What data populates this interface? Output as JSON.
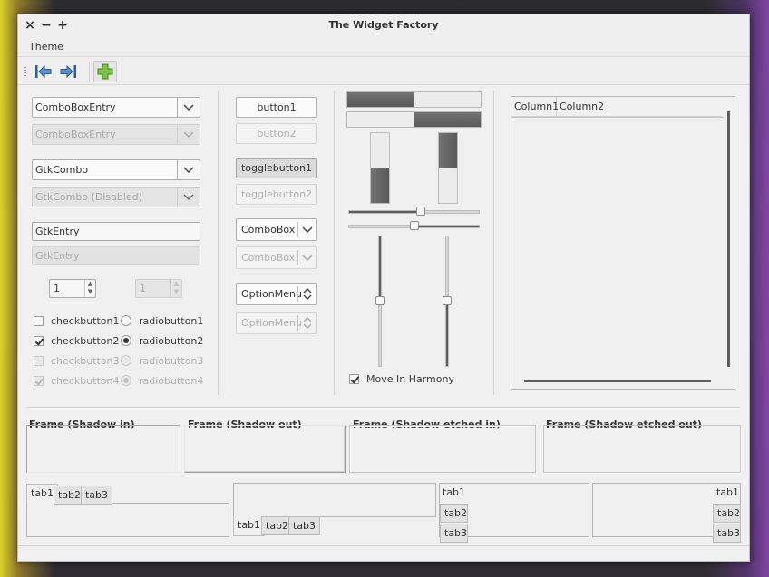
{
  "window": {
    "title": "The Widget Factory"
  },
  "titlebar": {
    "close": "×",
    "minimize": "−",
    "maximize": "+"
  },
  "menubar": {
    "items": [
      "Theme"
    ]
  },
  "toolbar": {
    "items": [
      "go-first-icon",
      "go-last-icon",
      "add-icon"
    ]
  },
  "col1": {
    "combo_entry": "ComboBoxEntry",
    "combo_entry_disabled": "ComboBoxEntry",
    "gtk_combo": "GtkCombo",
    "gtk_combo_disabled": "GtkCombo (Disabled)",
    "entry": "GtkEntry",
    "entry_disabled": "GtkEntry",
    "spin_value": "1",
    "spin_disabled_value": "1",
    "checkbuttons": [
      "checkbutton1",
      "checkbutton2",
      "checkbutton3",
      "checkbutton4"
    ],
    "radiobuttons": [
      "radiobutton1",
      "radiobutton2",
      "radiobutton3",
      "radiobutton4"
    ]
  },
  "col2": {
    "button1": "button1",
    "button2": "button2",
    "togglebutton1": "togglebutton1",
    "togglebutton2": "togglebutton2",
    "combobox": "ComboBox",
    "combobox_disabled": "ComboBox",
    "optionmenu": "OptionMenu",
    "optionmenu_disabled": "OptionMenu"
  },
  "col3": {
    "progress_h1": 0.5,
    "progress_h2": 0.5,
    "progress_v1": 0.5,
    "progress_v2": 0.5,
    "scale_h1": 0.55,
    "scale_h2": 0.5,
    "move_in_harmony": "Move In Harmony"
  },
  "tree": {
    "columns": [
      "Column1",
      "Column2"
    ]
  },
  "frames": [
    "Frame (Shadow in)",
    "Frame (Shadow out)",
    "Frame (Shadow etched in)",
    "Frame (Shadow etched out)"
  ],
  "notebooks": {
    "tabs": [
      "tab1",
      "tab2",
      "tab3"
    ]
  }
}
